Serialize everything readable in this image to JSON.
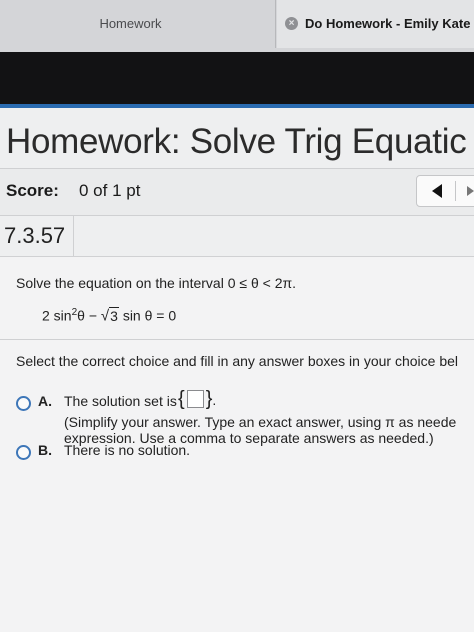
{
  "browser": {
    "tabs": [
      {
        "label": "Homework"
      },
      {
        "label": "Do Homework - Emily Kate",
        "close_glyph": "×"
      }
    ]
  },
  "page": {
    "title": "Homework: Solve Trig Equatic"
  },
  "score": {
    "label": "Score:",
    "value": "0 of 1 pt"
  },
  "problem": {
    "number": "7.3.57"
  },
  "question": {
    "instruction": "Solve the equation on the interval 0 ≤ θ < 2π.",
    "equation": {
      "left_coeff": "2 sin",
      "exponent": "2",
      "after_exp": "θ −",
      "sqrt_symbol": "√",
      "radicand": "3",
      "tail": "sin θ = 0"
    },
    "select_instruction": "Select the correct choice and fill in any answer boxes in your choice bel"
  },
  "choices": {
    "a": {
      "letter": "A.",
      "text": "The solution set is",
      "brace_open": "{",
      "brace_close": "}",
      "period": ".",
      "hint_line1": "(Simplify your answer.  Type an exact answer, using π as neede",
      "hint_line2": "expression.  Use a comma to separate answers as needed.)"
    },
    "b": {
      "letter": "B.",
      "text": "There is no solution."
    }
  },
  "colors": {
    "accent_blue": "#2a6bb0",
    "radio_border": "#3d76b8",
    "dark_band": "#121214"
  },
  "icons": {
    "prev": "triangle-left-icon",
    "next": "triangle-right-icon",
    "close": "close-circle-icon"
  }
}
